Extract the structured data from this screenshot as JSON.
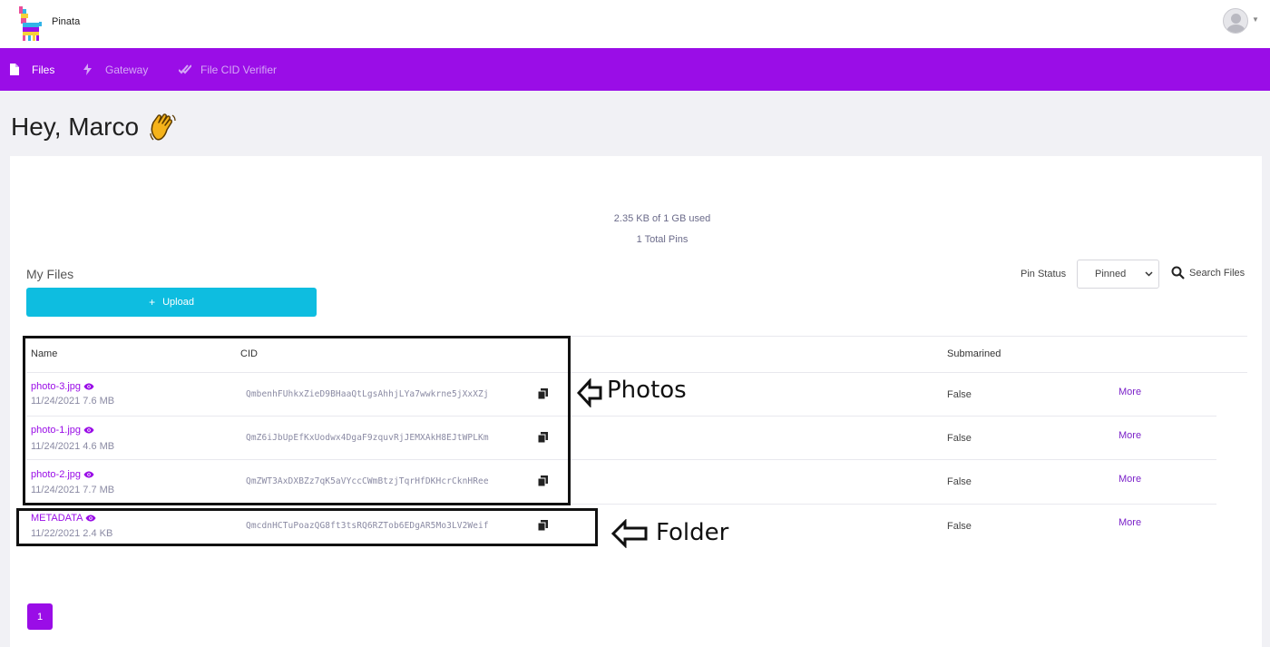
{
  "app": {
    "name": "Pinata"
  },
  "nav": {
    "items": [
      {
        "label": "Files",
        "icon": "file-icon",
        "active": true
      },
      {
        "label": "Gateway",
        "icon": "bolt-icon",
        "active": false
      },
      {
        "label": "File CID Verifier",
        "icon": "check-icon",
        "active": false
      }
    ]
  },
  "greeting": {
    "text": "Hey, Marco",
    "emoji": "waving-hand-icon"
  },
  "usage": {
    "storage": "2.35 KB of 1 GB used",
    "pins": "1 Total Pins"
  },
  "files": {
    "title": "My Files",
    "upload_label": "Upload",
    "pin_status_label": "Pin Status",
    "pin_status_value": "Pinned",
    "search_label": "Search Files",
    "columns": {
      "name": "Name",
      "cid": "CID",
      "submarined": "Submarined"
    },
    "rows": [
      {
        "name": "photo-3.jpg",
        "meta": "11/24/2021 7.6 MB",
        "cid": "QmbenhFUhkxZieD9BHaaQtLgsAhhjLYa7wwkrne5jXxXZj",
        "submarined": "False",
        "more": "More"
      },
      {
        "name": "photo-1.jpg",
        "meta": "11/24/2021 4.6 MB",
        "cid": "QmZ6iJbUpEfKxUodwx4DgaF9zquvRjJEMXAkH8EJtWPLKm",
        "submarined": "False",
        "more": "More"
      },
      {
        "name": "photo-2.jpg",
        "meta": "11/24/2021 7.7 MB",
        "cid": "QmZWT3AxDXBZz7qK5aVYccCWmBtzjTqrHfDKHcrCknHRee",
        "submarined": "False",
        "more": "More"
      },
      {
        "name": "METADATA",
        "meta": "11/22/2021 2.4 KB",
        "cid": "QmcdnHCTuPoazQG8ft3tsRQ6RZTob6EDgAR5Mo3LV2Weif",
        "submarined": "False",
        "more": "More"
      }
    ]
  },
  "annotations": {
    "photos_label": "Photos",
    "folder_label": "Folder"
  },
  "pagination": {
    "current": "1"
  },
  "colors": {
    "brand": "#9a0de7",
    "upload": "#0ebde0"
  }
}
